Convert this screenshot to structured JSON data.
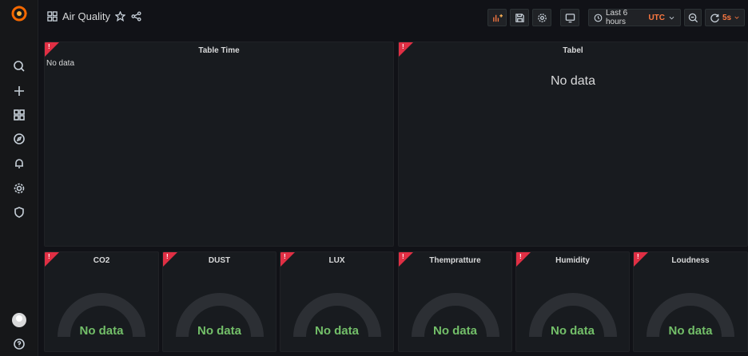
{
  "dashboard": {
    "title": "Air Quality"
  },
  "toolbar": {
    "time_range": "Last 6 hours",
    "timezone": "UTC",
    "refresh_interval": "5s"
  },
  "panels": {
    "table_time": {
      "title": "Table Time",
      "message": "No data"
    },
    "tabel": {
      "title": "Tabel",
      "message": "No data"
    },
    "gauges": [
      {
        "title": "CO2",
        "message": "No data"
      },
      {
        "title": "DUST",
        "message": "No data"
      },
      {
        "title": "LUX",
        "message": "No data"
      },
      {
        "title": "Thempratture",
        "message": "No data"
      },
      {
        "title": "Humidity",
        "message": "No data"
      },
      {
        "title": "Loudness",
        "message": "No data"
      }
    ]
  },
  "colors": {
    "background": "#111217",
    "panel": "#181b1f",
    "error": "#e02f44",
    "gauge_text": "#73bf69",
    "accent": "#ff7941"
  },
  "icons": {
    "sidebar": [
      "grafana-logo-icon",
      "search-icon",
      "plus-icon",
      "dashboards-icon",
      "explore-icon",
      "alerting-icon",
      "settings-icon",
      "shield-icon",
      "help-icon"
    ],
    "topbar": [
      "dashboards-icon",
      "star-icon",
      "share-icon",
      "add-panel-icon",
      "save-icon",
      "settings-icon",
      "tv-icon",
      "clock-icon",
      "zoom-out-icon",
      "refresh-icon"
    ]
  }
}
